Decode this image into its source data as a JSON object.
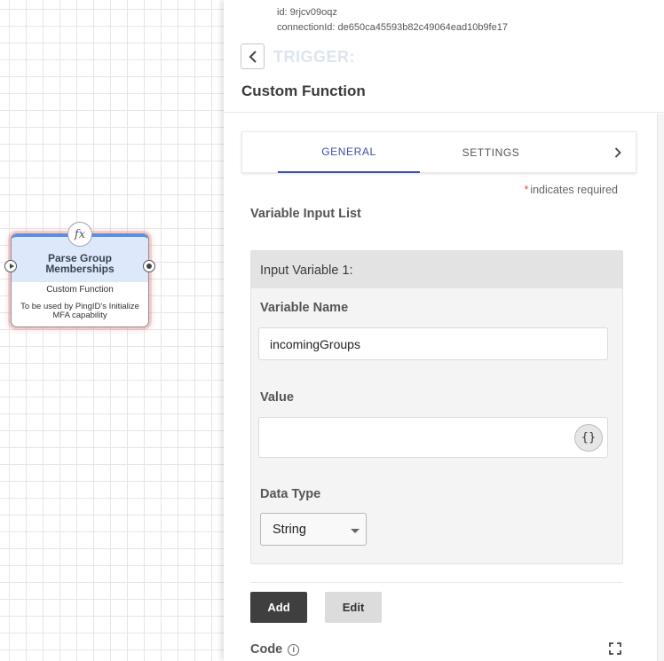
{
  "canvas": {
    "node": {
      "icon": "function-icon",
      "icon_glyph": "fx",
      "title": "Parse Group Memberships",
      "type": "Custom Function",
      "description": "To be used by PingID's Initialize MFA capability"
    }
  },
  "panel": {
    "id_line": "id: 9rjcv09oqz",
    "connection_line": "connectionId: de650ca45593b82c49064ead10b9fe17",
    "back_icon": "chevron-left-icon",
    "trigger_label": "TRIGGER:",
    "title": "Custom Function",
    "tabs": [
      {
        "label": "GENERAL",
        "active": true
      },
      {
        "label": "SETTINGS",
        "active": false
      }
    ],
    "tab_next_icon": "chevron-right-icon",
    "required_note": "indicates required",
    "required_star": "*",
    "section_label": "Variable Input List",
    "variable_card": {
      "header": "Input Variable 1:",
      "name_label": "Variable Name",
      "name_value": "incomingGroups",
      "value_label": "Value",
      "value_value": "",
      "braces_label": "{}",
      "data_type_label": "Data Type",
      "data_type_value": "String"
    },
    "add_label": "Add",
    "edit_label": "Edit",
    "code_label": "Code",
    "info_glyph": "i",
    "expand_icon": "fullscreen-icon"
  },
  "colors": {
    "accent": "#3d4fa8",
    "required": "#e0523f",
    "node_header": "#dde9fb",
    "node_top_bar": "#4f8ef5"
  }
}
